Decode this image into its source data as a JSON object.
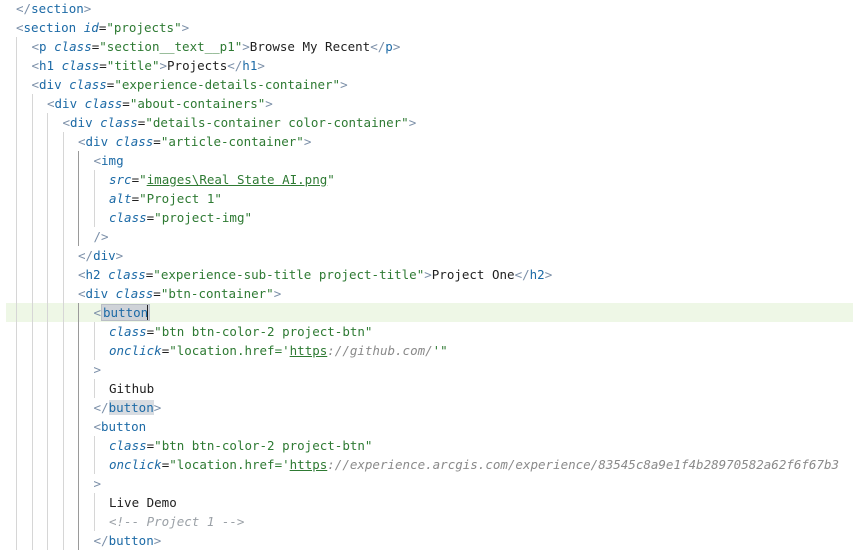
{
  "code": {
    "lines": [
      {
        "indent": 0,
        "tokens": [
          {
            "t": "</",
            "c": "punct"
          },
          {
            "t": "section",
            "c": "tag"
          },
          {
            "t": ">",
            "c": "punct"
          }
        ]
      },
      {
        "indent": 0,
        "tokens": [
          {
            "t": "<",
            "c": "punct"
          },
          {
            "t": "section",
            "c": "tag"
          },
          {
            "t": " ",
            "c": "text"
          },
          {
            "t": "id",
            "c": "attr"
          },
          {
            "t": "=",
            "c": "text"
          },
          {
            "t": "\"projects\"",
            "c": "str"
          },
          {
            "t": ">",
            "c": "punct"
          }
        ]
      },
      {
        "indent": 1,
        "tokens": [
          {
            "t": "<",
            "c": "punct"
          },
          {
            "t": "p",
            "c": "tag"
          },
          {
            "t": " ",
            "c": "text"
          },
          {
            "t": "class",
            "c": "attr"
          },
          {
            "t": "=",
            "c": "text"
          },
          {
            "t": "\"section__text__p1\"",
            "c": "str"
          },
          {
            "t": ">",
            "c": "punct"
          },
          {
            "t": "Browse My Recent",
            "c": "text"
          },
          {
            "t": "</",
            "c": "punct"
          },
          {
            "t": "p",
            "c": "tag"
          },
          {
            "t": ">",
            "c": "punct"
          }
        ]
      },
      {
        "indent": 1,
        "tokens": [
          {
            "t": "<",
            "c": "punct"
          },
          {
            "t": "h1",
            "c": "tag"
          },
          {
            "t": " ",
            "c": "text"
          },
          {
            "t": "class",
            "c": "attr"
          },
          {
            "t": "=",
            "c": "text"
          },
          {
            "t": "\"title\"",
            "c": "str"
          },
          {
            "t": ">",
            "c": "punct"
          },
          {
            "t": "Projects",
            "c": "text"
          },
          {
            "t": "</",
            "c": "punct"
          },
          {
            "t": "h1",
            "c": "tag"
          },
          {
            "t": ">",
            "c": "punct"
          }
        ]
      },
      {
        "indent": 1,
        "tokens": [
          {
            "t": "<",
            "c": "punct"
          },
          {
            "t": "div",
            "c": "tag"
          },
          {
            "t": " ",
            "c": "text"
          },
          {
            "t": "class",
            "c": "attr"
          },
          {
            "t": "=",
            "c": "text"
          },
          {
            "t": "\"experience-details-container\"",
            "c": "str"
          },
          {
            "t": ">",
            "c": "punct"
          }
        ]
      },
      {
        "indent": 2,
        "tokens": [
          {
            "t": "<",
            "c": "punct"
          },
          {
            "t": "div",
            "c": "tag"
          },
          {
            "t": " ",
            "c": "text"
          },
          {
            "t": "class",
            "c": "attr"
          },
          {
            "t": "=",
            "c": "text"
          },
          {
            "t": "\"about-containers\"",
            "c": "str"
          },
          {
            "t": ">",
            "c": "punct"
          }
        ]
      },
      {
        "indent": 3,
        "tokens": [
          {
            "t": "<",
            "c": "punct"
          },
          {
            "t": "div",
            "c": "tag"
          },
          {
            "t": " ",
            "c": "text"
          },
          {
            "t": "class",
            "c": "attr"
          },
          {
            "t": "=",
            "c": "text"
          },
          {
            "t": "\"details-container color-container\"",
            "c": "str"
          },
          {
            "t": ">",
            "c": "punct"
          }
        ]
      },
      {
        "indent": 4,
        "tokens": [
          {
            "t": "<",
            "c": "punct"
          },
          {
            "t": "div",
            "c": "tag"
          },
          {
            "t": " ",
            "c": "text"
          },
          {
            "t": "class",
            "c": "attr"
          },
          {
            "t": "=",
            "c": "text"
          },
          {
            "t": "\"article-container\"",
            "c": "str"
          },
          {
            "t": ">",
            "c": "punct"
          }
        ]
      },
      {
        "indent": 5,
        "tokens": [
          {
            "t": "<",
            "c": "punct"
          },
          {
            "t": "img",
            "c": "tag"
          }
        ]
      },
      {
        "indent": 6,
        "tokens": [
          {
            "t": "src",
            "c": "attr"
          },
          {
            "t": "=",
            "c": "text"
          },
          {
            "t": "\"",
            "c": "str"
          },
          {
            "t": "images\\Real State AI.png",
            "c": "url"
          },
          {
            "t": "\"",
            "c": "str"
          }
        ]
      },
      {
        "indent": 6,
        "tokens": [
          {
            "t": "alt",
            "c": "attr"
          },
          {
            "t": "=",
            "c": "text"
          },
          {
            "t": "\"Project 1\"",
            "c": "str"
          }
        ]
      },
      {
        "indent": 6,
        "tokens": [
          {
            "t": "class",
            "c": "attr"
          },
          {
            "t": "=",
            "c": "text"
          },
          {
            "t": "\"project-img\"",
            "c": "str"
          }
        ]
      },
      {
        "indent": 5,
        "tokens": [
          {
            "t": "/>",
            "c": "punct"
          }
        ]
      },
      {
        "indent": 4,
        "tokens": [
          {
            "t": "</",
            "c": "punct"
          },
          {
            "t": "div",
            "c": "tag"
          },
          {
            "t": ">",
            "c": "punct"
          }
        ]
      },
      {
        "indent": 4,
        "tokens": [
          {
            "t": "<",
            "c": "punct"
          },
          {
            "t": "h2",
            "c": "tag"
          },
          {
            "t": " ",
            "c": "text"
          },
          {
            "t": "class",
            "c": "attr"
          },
          {
            "t": "=",
            "c": "text"
          },
          {
            "t": "\"experience-sub-title project-title\"",
            "c": "str"
          },
          {
            "t": ">",
            "c": "punct"
          },
          {
            "t": "Project One",
            "c": "text"
          },
          {
            "t": "</",
            "c": "punct"
          },
          {
            "t": "h2",
            "c": "tag"
          },
          {
            "t": ">",
            "c": "punct"
          }
        ]
      },
      {
        "indent": 4,
        "tokens": [
          {
            "t": "<",
            "c": "punct"
          },
          {
            "t": "div",
            "c": "tag"
          },
          {
            "t": " ",
            "c": "text"
          },
          {
            "t": "class",
            "c": "attr"
          },
          {
            "t": "=",
            "c": "text"
          },
          {
            "t": "\"btn-container\"",
            "c": "str"
          },
          {
            "t": ">",
            "c": "punct"
          }
        ]
      },
      {
        "indent": 5,
        "current": true,
        "tokens": [
          {
            "t": "<",
            "c": "punct"
          },
          {
            "t": "button",
            "c": "tag hl-box"
          }
        ]
      },
      {
        "indent": 6,
        "tokens": [
          {
            "t": "class",
            "c": "attr"
          },
          {
            "t": "=",
            "c": "text"
          },
          {
            "t": "\"btn btn-color-2 project-btn\"",
            "c": "str"
          }
        ]
      },
      {
        "indent": 6,
        "tokens": [
          {
            "t": "onclick",
            "c": "attr"
          },
          {
            "t": "=",
            "c": "text"
          },
          {
            "t": "\"location.href=",
            "c": "str"
          },
          {
            "t": "'",
            "c": "str"
          },
          {
            "t": "https",
            "c": "url"
          },
          {
            "t": "://github.com/",
            "c": "url-rest"
          },
          {
            "t": "'\"",
            "c": "str"
          }
        ]
      },
      {
        "indent": 5,
        "tokens": [
          {
            "t": ">",
            "c": "punct"
          }
        ]
      },
      {
        "indent": 6,
        "tokens": [
          {
            "t": "Github",
            "c": "text"
          }
        ]
      },
      {
        "indent": 5,
        "tokens": [
          {
            "t": "</",
            "c": "punct"
          },
          {
            "t": "button",
            "c": "tag hl"
          },
          {
            "t": ">",
            "c": "punct"
          }
        ]
      },
      {
        "indent": 5,
        "tokens": [
          {
            "t": "<",
            "c": "punct"
          },
          {
            "t": "button",
            "c": "tag"
          }
        ]
      },
      {
        "indent": 6,
        "tokens": [
          {
            "t": "class",
            "c": "attr"
          },
          {
            "t": "=",
            "c": "text"
          },
          {
            "t": "\"btn btn-color-2 project-btn\"",
            "c": "str"
          }
        ]
      },
      {
        "indent": 6,
        "tokens": [
          {
            "t": "onclick",
            "c": "attr"
          },
          {
            "t": "=",
            "c": "text"
          },
          {
            "t": "\"location.href=",
            "c": "str"
          },
          {
            "t": "'",
            "c": "str"
          },
          {
            "t": "https",
            "c": "url"
          },
          {
            "t": "://experience.arcgis.com/experience/83545c8a9e1f4b28970582a62f6f67b3",
            "c": "url-rest"
          }
        ]
      },
      {
        "indent": 5,
        "tokens": [
          {
            "t": ">",
            "c": "punct"
          }
        ]
      },
      {
        "indent": 6,
        "tokens": [
          {
            "t": "Live Demo",
            "c": "text"
          }
        ]
      },
      {
        "indent": 6,
        "tokens": [
          {
            "t": "<!-- Project 1 -->",
            "c": "comment"
          }
        ]
      },
      {
        "indent": 5,
        "tokens": [
          {
            "t": "</",
            "c": "punct"
          },
          {
            "t": "button",
            "c": "tag"
          },
          {
            "t": ">",
            "c": "punct"
          }
        ]
      }
    ]
  }
}
